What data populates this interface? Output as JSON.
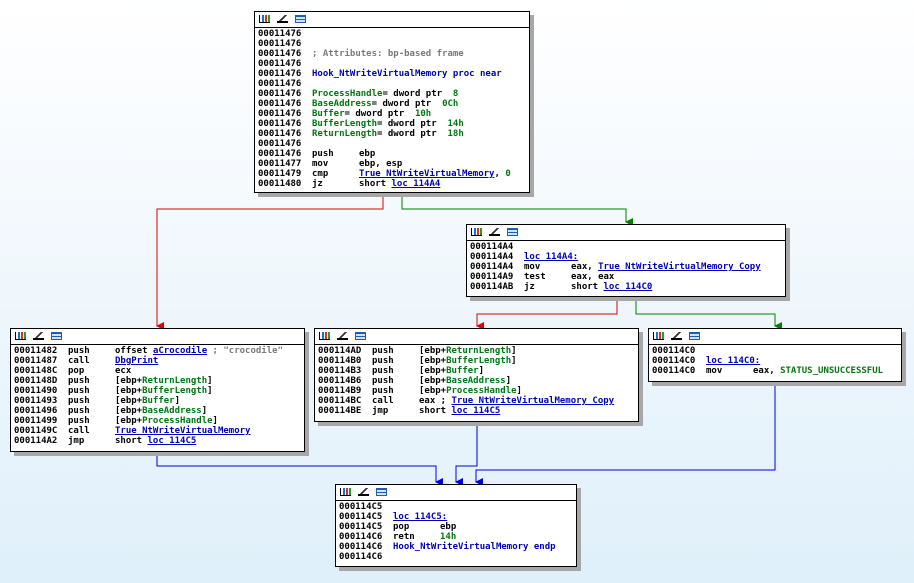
{
  "colors": {
    "edge_false": "#e00000",
    "edge_true": "#008000",
    "edge_uncond": "#0000e0"
  },
  "nodes": [
    {
      "id": "entry",
      "lines": [
        {
          "addr": "00011476"
        },
        {
          "addr": "00011476"
        },
        {
          "addr": "00011476",
          "toks": [
            {
              "t": "; Attributes: bp-based frame",
              "c": "com"
            }
          ]
        },
        {
          "addr": "00011476"
        },
        {
          "addr": "00011476",
          "toks": [
            {
              "t": "Hook_NtWriteVirtualMemory",
              "c": "name"
            },
            {
              "t": " proc near",
              "c": "name"
            }
          ]
        },
        {
          "addr": "00011476"
        },
        {
          "addr": "00011476",
          "toks": [
            {
              "t": "ProcessHandle",
              "c": "var"
            },
            {
              "t": "= dword ptr  ",
              "c": "dir"
            },
            {
              "t": "8",
              "c": "num"
            }
          ]
        },
        {
          "addr": "00011476",
          "toks": [
            {
              "t": "BaseAddress",
              "c": "var"
            },
            {
              "t": "= dword ptr  ",
              "c": "dir"
            },
            {
              "t": "0Ch",
              "c": "num"
            }
          ]
        },
        {
          "addr": "00011476",
          "toks": [
            {
              "t": "Buffer",
              "c": "var"
            },
            {
              "t": "= dword ptr  ",
              "c": "dir"
            },
            {
              "t": "10h",
              "c": "num"
            }
          ]
        },
        {
          "addr": "00011476",
          "toks": [
            {
              "t": "BufferLength",
              "c": "var"
            },
            {
              "t": "= dword ptr  ",
              "c": "dir"
            },
            {
              "t": "14h",
              "c": "num"
            }
          ]
        },
        {
          "addr": "00011476",
          "toks": [
            {
              "t": "ReturnLength",
              "c": "var"
            },
            {
              "t": "= dword ptr  ",
              "c": "dir"
            },
            {
              "t": "18h",
              "c": "num"
            }
          ]
        },
        {
          "addr": "00011476"
        },
        {
          "addr": "00011476",
          "mn": "push",
          "toks": [
            {
              "t": "ebp",
              "c": "reg"
            }
          ]
        },
        {
          "addr": "00011477",
          "mn": "mov",
          "toks": [
            {
              "t": "ebp, esp",
              "c": "reg"
            }
          ]
        },
        {
          "addr": "00011479",
          "mn": "cmp",
          "toks": [
            {
              "t": "True_NtWriteVirtualMemory",
              "c": "name"
            },
            {
              "t": ", ",
              "c": "plain"
            },
            {
              "t": "0",
              "c": "num"
            }
          ]
        },
        {
          "addr": "00011480",
          "mn": "jz",
          "toks": [
            {
              "t": "short ",
              "c": "plain"
            },
            {
              "t": "loc_114A4",
              "c": "name"
            }
          ]
        }
      ]
    },
    {
      "id": "loc_114a4",
      "lines": [
        {
          "addr": "000114A4"
        },
        {
          "addr": "000114A4",
          "toks": [
            {
              "t": "loc_114A4:",
              "c": "name"
            }
          ]
        },
        {
          "addr": "000114A4",
          "mn": "mov",
          "toks": [
            {
              "t": "eax, ",
              "c": "reg"
            },
            {
              "t": "True_NtWriteVirtualMemory_Copy",
              "c": "name"
            }
          ]
        },
        {
          "addr": "000114A9",
          "mn": "test",
          "toks": [
            {
              "t": "eax, eax",
              "c": "reg"
            }
          ]
        },
        {
          "addr": "000114AB",
          "mn": "jz",
          "toks": [
            {
              "t": "short ",
              "c": "plain"
            },
            {
              "t": "loc_114C0",
              "c": "name"
            }
          ]
        }
      ]
    },
    {
      "id": "crocodile",
      "lines": [
        {
          "addr": "00011482",
          "mn": "push",
          "toks": [
            {
              "t": "offset ",
              "c": "plain"
            },
            {
              "t": "aCrocodile",
              "c": "name"
            },
            {
              "t": " ; \"crocodile\"",
              "c": "str"
            }
          ]
        },
        {
          "addr": "00011487",
          "mn": "call",
          "toks": [
            {
              "t": "DbgPrint",
              "c": "name"
            }
          ]
        },
        {
          "addr": "0001148C",
          "mn": "pop",
          "toks": [
            {
              "t": "ecx",
              "c": "reg"
            }
          ]
        },
        {
          "addr": "0001148D",
          "mn": "push",
          "toks": [
            {
              "t": "[ebp+",
              "c": "plain"
            },
            {
              "t": "ReturnLength",
              "c": "var"
            },
            {
              "t": "]",
              "c": "plain"
            }
          ]
        },
        {
          "addr": "00011490",
          "mn": "push",
          "toks": [
            {
              "t": "[ebp+",
              "c": "plain"
            },
            {
              "t": "BufferLength",
              "c": "var"
            },
            {
              "t": "]",
              "c": "plain"
            }
          ]
        },
        {
          "addr": "00011493",
          "mn": "push",
          "toks": [
            {
              "t": "[ebp+",
              "c": "plain"
            },
            {
              "t": "Buffer",
              "c": "var"
            },
            {
              "t": "]",
              "c": "plain"
            }
          ]
        },
        {
          "addr": "00011496",
          "mn": "push",
          "toks": [
            {
              "t": "[ebp+",
              "c": "plain"
            },
            {
              "t": "BaseAddress",
              "c": "var"
            },
            {
              "t": "]",
              "c": "plain"
            }
          ]
        },
        {
          "addr": "00011499",
          "mn": "push",
          "toks": [
            {
              "t": "[ebp+",
              "c": "plain"
            },
            {
              "t": "ProcessHandle",
              "c": "var"
            },
            {
              "t": "]",
              "c": "plain"
            }
          ]
        },
        {
          "addr": "0001149C",
          "mn": "call",
          "toks": [
            {
              "t": "True_NtWriteVirtualMemory",
              "c": "name"
            }
          ]
        },
        {
          "addr": "000114A2",
          "mn": "jmp",
          "toks": [
            {
              "t": "short ",
              "c": "plain"
            },
            {
              "t": "loc_114C5",
              "c": "name"
            }
          ]
        }
      ]
    },
    {
      "id": "copy_call",
      "lines": [
        {
          "addr": "000114AD",
          "mn": "push",
          "toks": [
            {
              "t": "[ebp+",
              "c": "plain"
            },
            {
              "t": "ReturnLength",
              "c": "var"
            },
            {
              "t": "]",
              "c": "plain"
            }
          ]
        },
        {
          "addr": "000114B0",
          "mn": "push",
          "toks": [
            {
              "t": "[ebp+",
              "c": "plain"
            },
            {
              "t": "BufferLength",
              "c": "var"
            },
            {
              "t": "]",
              "c": "plain"
            }
          ]
        },
        {
          "addr": "000114B3",
          "mn": "push",
          "toks": [
            {
              "t": "[ebp+",
              "c": "plain"
            },
            {
              "t": "Buffer",
              "c": "var"
            },
            {
              "t": "]",
              "c": "plain"
            }
          ]
        },
        {
          "addr": "000114B6",
          "mn": "push",
          "toks": [
            {
              "t": "[ebp+",
              "c": "plain"
            },
            {
              "t": "BaseAddress",
              "c": "var"
            },
            {
              "t": "]",
              "c": "plain"
            }
          ]
        },
        {
          "addr": "000114B9",
          "mn": "push",
          "toks": [
            {
              "t": "[ebp+",
              "c": "plain"
            },
            {
              "t": "ProcessHandle",
              "c": "var"
            },
            {
              "t": "]",
              "c": "plain"
            }
          ]
        },
        {
          "addr": "000114BC",
          "mn": "call",
          "toks": [
            {
              "t": "eax ; ",
              "c": "plain"
            },
            {
              "t": "True_NtWriteVirtualMemory_Copy",
              "c": "name"
            }
          ]
        },
        {
          "addr": "000114BE",
          "mn": "jmp",
          "toks": [
            {
              "t": "short ",
              "c": "plain"
            },
            {
              "t": "loc_114C5",
              "c": "name"
            }
          ]
        }
      ]
    },
    {
      "id": "loc_114c0",
      "lines": [
        {
          "addr": "000114C0"
        },
        {
          "addr": "000114C0",
          "toks": [
            {
              "t": "loc_114C0:",
              "c": "name"
            }
          ]
        },
        {
          "addr": "000114C0",
          "mn": "mov",
          "toks": [
            {
              "t": "eax, ",
              "c": "reg"
            },
            {
              "t": "STATUS_UNSUCCESSFUL",
              "c": "var"
            }
          ]
        }
      ]
    },
    {
      "id": "loc_114c5",
      "lines": [
        {
          "addr": "000114C5"
        },
        {
          "addr": "000114C5",
          "toks": [
            {
              "t": "loc_114C5:",
              "c": "name"
            }
          ]
        },
        {
          "addr": "000114C5",
          "mn": "pop",
          "toks": [
            {
              "t": "ebp",
              "c": "reg"
            }
          ]
        },
        {
          "addr": "000114C6",
          "mn": "retn",
          "toks": [
            {
              "t": "14h",
              "c": "num"
            }
          ]
        },
        {
          "addr": "000114C6",
          "toks": [
            {
              "t": "Hook_NtWriteVirtualMemory",
              "c": "name"
            },
            {
              "t": " endp",
              "c": "name"
            }
          ]
        },
        {
          "addr": "000114C6"
        }
      ]
    }
  ]
}
